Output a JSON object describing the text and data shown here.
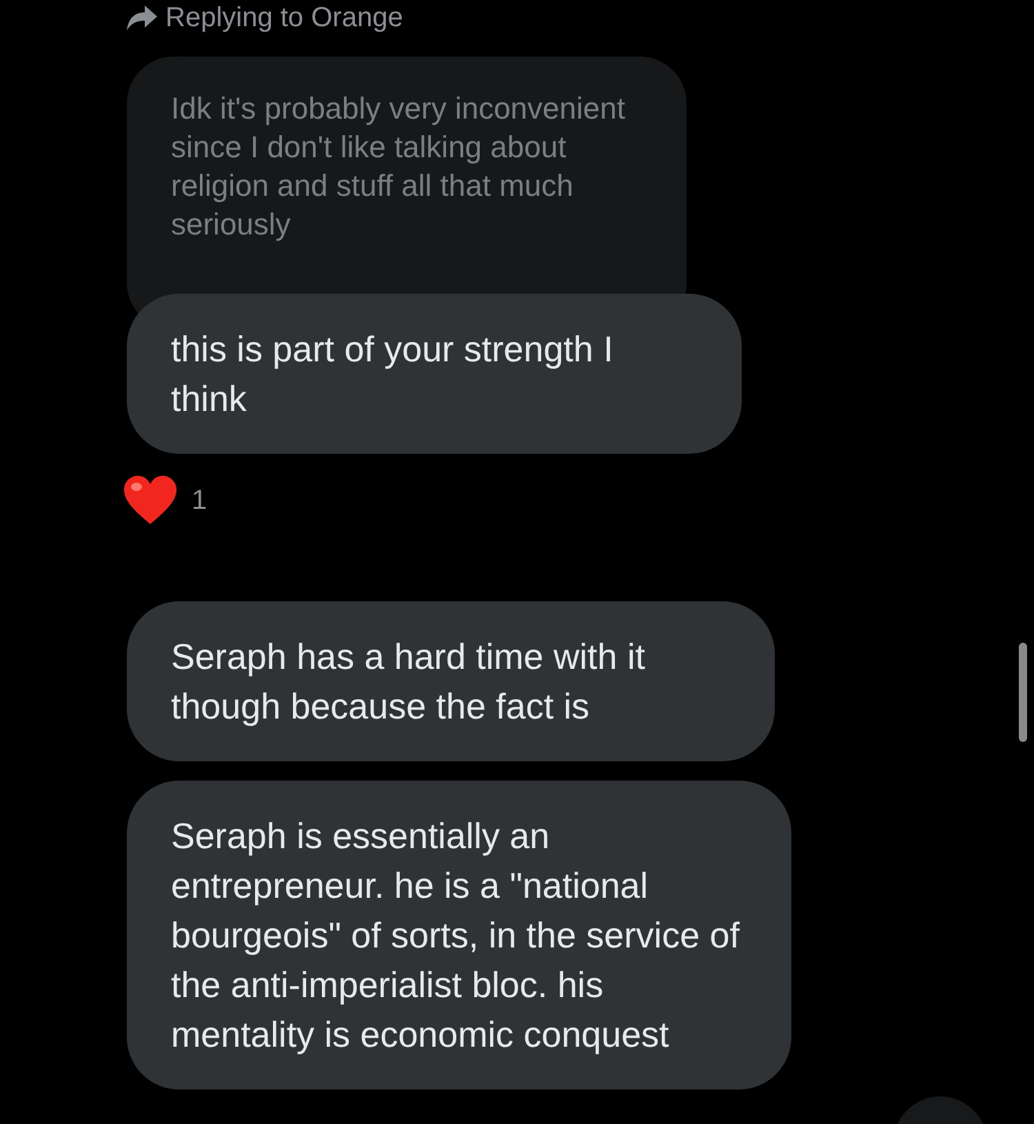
{
  "reply_context": {
    "label": "Replying to Orange"
  },
  "quoted_message": {
    "text": "Idk it's probably very inconvenient since I don't like talking about religion and stuff all that much seriously"
  },
  "messages": [
    {
      "text": "this is part of your strength I think",
      "reaction": {
        "count": "1"
      }
    },
    {
      "text": "Seraph has a hard time with it though because the fact is"
    },
    {
      "text": "Seraph is essentially an entrepreneur. he is a \"national bourgeois\" of sorts, in the service of the anti-imperialist bloc. his mentality is economic conquest"
    }
  ]
}
